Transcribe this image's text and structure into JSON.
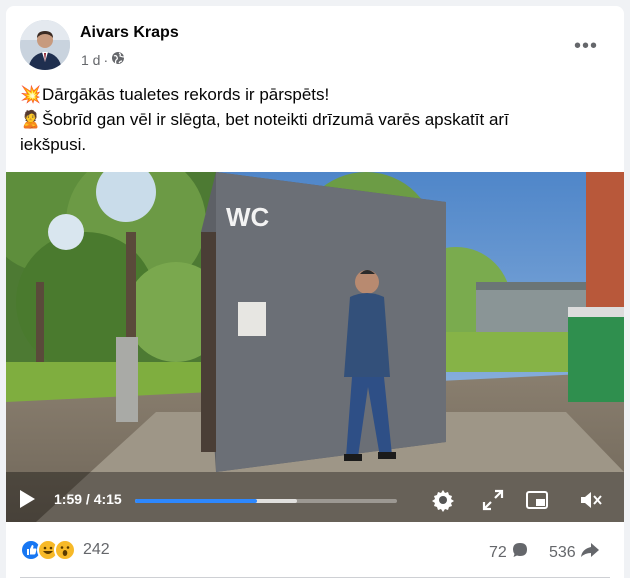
{
  "post": {
    "author": "Aivars Kraps",
    "time": "1 d",
    "separator": "·",
    "more_label": "•••",
    "text_line1": "Dārgākās tualetes rekords ir pārspēts!",
    "text_line2": "Šobrīd gan vēl ir slēgta, bet noteikti drīzumā varēs apskatīt arī",
    "text_line3": "iekšpusi.",
    "emoji1": "💥",
    "emoji2": "🙎"
  },
  "video": {
    "sign_text": "WC",
    "current_time": "1:59",
    "duration": "4:15",
    "time_display": "1:59 / 4:15",
    "progress_fraction": 0.467,
    "buffered_fraction": 0.62
  },
  "footer": {
    "reaction_count": "242",
    "comment_count": "72",
    "share_count": "536",
    "reactions": [
      "like",
      "haha",
      "wow"
    ]
  },
  "icons": {
    "globe": "globe-icon",
    "more": "more-icon",
    "play": "play-icon",
    "settings": "gear-icon",
    "fullscreen": "fullscreen-icon",
    "pip": "picture-in-picture-icon",
    "mute": "mute-icon",
    "comment": "comment-icon",
    "share": "share-icon"
  },
  "colors": {
    "accent": "#2d88ff",
    "like": "#1877f2",
    "haha": "#f7b928"
  }
}
